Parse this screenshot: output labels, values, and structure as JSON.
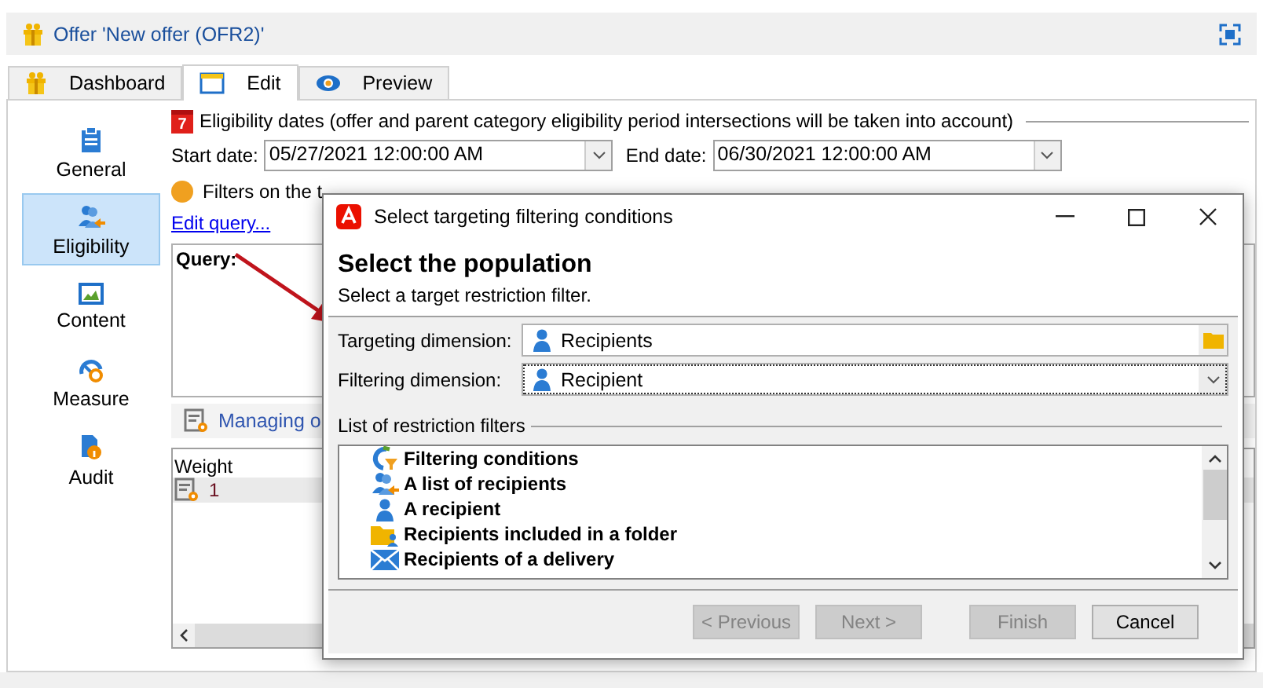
{
  "window": {
    "title": "Offer 'New offer (OFR2)'"
  },
  "tabs": [
    {
      "label": "Dashboard",
      "kind": "gift",
      "selected": false
    },
    {
      "label": "Edit",
      "kind": "form",
      "selected": true
    },
    {
      "label": "Preview",
      "kind": "eye",
      "selected": false
    }
  ],
  "sidebar": {
    "items": [
      {
        "label": "General",
        "kind": "clipboard",
        "selected": false
      },
      {
        "label": "Eligibility",
        "kind": "people",
        "selected": true
      },
      {
        "label": "Content",
        "kind": "image",
        "selected": false
      },
      {
        "label": "Measure",
        "kind": "gauge",
        "selected": false
      },
      {
        "label": "Audit",
        "kind": "audit",
        "selected": false
      }
    ]
  },
  "eligibility": {
    "section_title": "Eligibility dates (offer and parent category eligibility period intersections will be taken into account)",
    "calendar_day": "7",
    "start_label": "Start date:",
    "start_value": "05/27/2021 12:00:00 AM",
    "end_label": "End date:",
    "end_value": "06/30/2021 12:00:00 AM"
  },
  "filters": {
    "label": "Filters on the t",
    "edit_query_link": "Edit query...",
    "query_label": "Query:"
  },
  "managing": {
    "label": "Managing o"
  },
  "grid": {
    "columns": [
      "Weight"
    ],
    "rows": [
      {
        "value": "1",
        "selected": true
      }
    ]
  },
  "dialog": {
    "title": "Select targeting filtering conditions",
    "heading": "Select the population",
    "subtitle": "Select a target restriction filter.",
    "targeting_label": "Targeting dimension:",
    "targeting_value": "Recipients",
    "filtering_label": "Filtering dimension:",
    "filtering_value": "Recipient",
    "list_title": "List of restriction filters",
    "filters": [
      {
        "label": "Filtering conditions",
        "kind": "funnel"
      },
      {
        "label": "A list of recipients",
        "kind": "people"
      },
      {
        "label": "A recipient",
        "kind": "person"
      },
      {
        "label": "Recipients included in a folder",
        "kind": "folder"
      },
      {
        "label": "Recipients of a delivery",
        "kind": "mail"
      }
    ],
    "buttons": [
      {
        "label": "< Previous",
        "disabled": true
      },
      {
        "label": "Next >",
        "disabled": true
      },
      {
        "label": "Finish",
        "disabled": true
      },
      {
        "label": "Cancel",
        "disabled": false
      }
    ]
  }
}
